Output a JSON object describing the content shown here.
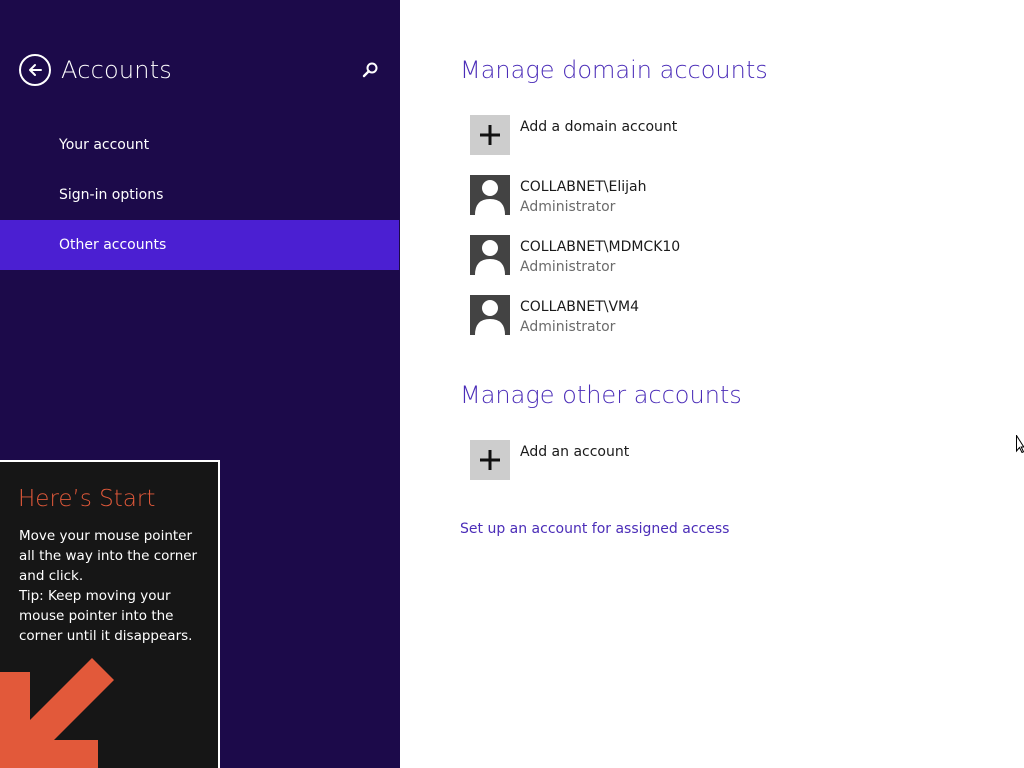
{
  "nav": {
    "title": "Accounts",
    "items": [
      {
        "label": "Your account",
        "selected": false
      },
      {
        "label": "Sign-in options",
        "selected": false
      },
      {
        "label": "Other accounts",
        "selected": true
      }
    ]
  },
  "tip": {
    "title": "Here’s Start",
    "lines": [
      "Move your mouse pointer",
      "all the way into the corner",
      "and click.",
      "Tip: Keep moving your",
      "mouse pointer into the",
      "corner until it disappears."
    ]
  },
  "domain_section": {
    "heading": "Manage domain accounts",
    "add_label": "Add a domain account",
    "accounts": [
      {
        "name": "COLLABNET\\Elijah",
        "role": "Administrator"
      },
      {
        "name": "COLLABNET\\MDMCK10",
        "role": "Administrator"
      },
      {
        "name": "COLLABNET\\VM4",
        "role": "Administrator"
      }
    ]
  },
  "other_section": {
    "heading": "Manage other accounts",
    "add_label": "Add an account"
  },
  "assigned_access_link": "Set up an account for assigned access",
  "colors": {
    "nav_background": "#1c0a4a",
    "nav_selected": "#4b1fd2",
    "accent": "#4b2db8",
    "tip_title": "#e2593a"
  }
}
